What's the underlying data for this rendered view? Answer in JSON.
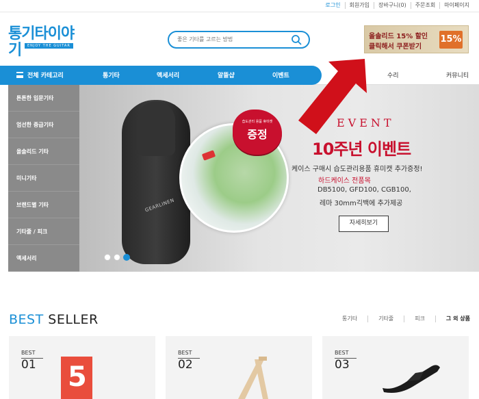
{
  "util_links": [
    "로그인",
    "회원가입",
    "장바구니(0)",
    "주문조회",
    "마이페이지"
  ],
  "logo": {
    "main": "통기타이야기",
    "sub": "ENJOY THE GUITAR"
  },
  "search": {
    "placeholder": "좋은 기타를 고르는 방법"
  },
  "coupon": {
    "line1": "올솔리드 15% 할인",
    "line2": "클릭해서 쿠폰받기",
    "percent": "15%"
  },
  "nav": {
    "all_categories": "전체 카테고리",
    "items": [
      "통기타",
      "액세서리",
      "알뜰샵",
      "이벤트",
      "수리",
      "커뮤니티"
    ]
  },
  "sidebar": [
    "튼튼한 입문기타",
    "엄선한 중급기타",
    "올솔리드 기타",
    "미니기타",
    "브랜드별 기타",
    "기타줄 / 피크",
    "액세서리"
  ],
  "banner": {
    "badge_small": "습도관리 용품 휴미캣",
    "badge_big": "증정",
    "case_brand": "GEARLINEN",
    "event_label": "EVENT",
    "title": "10주년 이벤트",
    "line1": "케이스 구매시 습도관리용품 휴미캣 추가증정!",
    "line2": "하드케이스 전품목",
    "line3": "DB5100, GFD100, CGB100,",
    "line4": "레마 30mm긱백에 추가제공",
    "button": "자세히보기",
    "slide_index": 3,
    "slide_count": 3
  },
  "best": {
    "title_accent": "BEST",
    "title_rest": "SELLER",
    "tabs": [
      "통기타",
      "기타줄",
      "피크",
      "그 외 상품"
    ],
    "cards": [
      {
        "label": "BEST",
        "num": "01",
        "book_num": "5"
      },
      {
        "label": "BEST",
        "num": "02"
      },
      {
        "label": "BEST",
        "num": "03"
      }
    ]
  },
  "colors": {
    "brand": "#1a8fd6",
    "event_red": "#c8102e",
    "sidebar_gray": "#8a8a8a"
  }
}
